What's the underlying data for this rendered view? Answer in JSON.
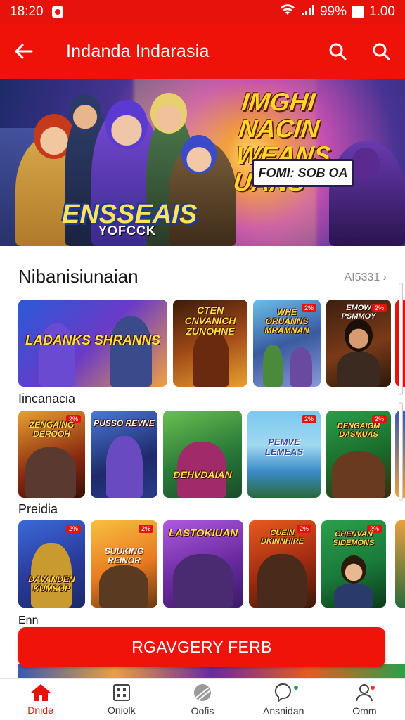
{
  "status_bar": {
    "time": "18:20",
    "battery": "99%",
    "extra": "1.00"
  },
  "app_bar": {
    "title": "Indanda Indarasia"
  },
  "banner": {
    "headline": "IMGHI NACIN WEANS UANS",
    "tag": "FOMI: SOB OA",
    "logo": "ENSSEAIS",
    "logo_sub": "YOFCCK"
  },
  "section": {
    "title": "Nibanisiunaian",
    "more": "AI5331 ›"
  },
  "rows": [
    {
      "label": "",
      "cards": [
        {
          "title": "LADANKS SHRANNS",
          "badge": ""
        },
        {
          "title": "CTEN CNVANICH ZUNOHNE",
          "badge": ""
        },
        {
          "title": "WHE ORUANNS MRAMNAN",
          "badge": "2%"
        },
        {
          "title": "EMOW PSMMOY",
          "badge": "2%"
        }
      ]
    },
    {
      "label": "Iincanacia",
      "cards": [
        {
          "title": "ZENGAING DEROOH",
          "badge": "2%"
        },
        {
          "title": "PUSSO REVNE",
          "badge": ""
        },
        {
          "title": "DEHVDAIAN",
          "badge": ""
        },
        {
          "title": "PEMVE LEMEAS",
          "badge": "2%"
        },
        {
          "title": "DENGAIGM DASMUAS",
          "badge": "2%"
        }
      ]
    },
    {
      "label": "Preidia",
      "cards": [
        {
          "title": "DAVANDEN KUMSOP",
          "badge": "2%"
        },
        {
          "title": "SUUKING REINOR",
          "badge": "2%"
        },
        {
          "title": "LASTOKIUAN",
          "badge": ""
        },
        {
          "title": "CUEIN DKINNHIRE",
          "badge": "2%"
        },
        {
          "title": "CHENVAN SIDEMONS",
          "badge": "2%"
        }
      ]
    },
    {
      "label": "Enn"
    }
  ],
  "cta": {
    "label": "RGAVGERY FERB"
  },
  "bottom_nav": [
    {
      "label": "Dnide",
      "icon": "home-icon",
      "active": true
    },
    {
      "label": "Oniolk",
      "icon": "grid-icon",
      "active": false
    },
    {
      "label": "Oofis",
      "icon": "ball-icon",
      "active": false
    },
    {
      "label": "Ansnidan",
      "icon": "chat-icon",
      "active": false
    },
    {
      "label": "Omm",
      "icon": "profile-icon",
      "active": false
    }
  ],
  "colors": {
    "accent": "#ee1208"
  }
}
